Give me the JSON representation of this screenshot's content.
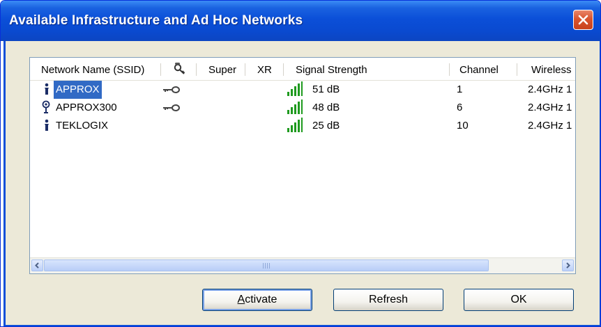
{
  "window": {
    "title": "Available Infrastructure and Ad Hoc Networks"
  },
  "columns": {
    "ssid": "Network Name (SSID)",
    "security_icon": "key-lock-icon",
    "super": "Super",
    "xr": "XR",
    "signal": "Signal Strength",
    "channel": "Channel",
    "wireless": "Wireless"
  },
  "networks": [
    {
      "name": "APPROX",
      "type_icon": "adhoc-person-icon",
      "secured": true,
      "signal": "51 dB",
      "channel": "1",
      "wireless": "2.4GHz 1",
      "selected": true
    },
    {
      "name": "APPROX300",
      "type_icon": "access-point-icon",
      "secured": true,
      "signal": "48 dB",
      "channel": "6",
      "wireless": "2.4GHz 1",
      "selected": false
    },
    {
      "name": "TEKLOGIX",
      "type_icon": "adhoc-person-icon",
      "secured": false,
      "signal": "25 dB",
      "channel": "10",
      "wireless": "2.4GHz 1",
      "selected": false
    }
  ],
  "buttons": {
    "activate": "Activate",
    "refresh": "Refresh",
    "ok": "OK"
  },
  "colors": {
    "selection": "#316ac5",
    "signal_bars": "#1e9a1e",
    "titlebar": "#0b4fd8",
    "close": "#d9542e"
  }
}
